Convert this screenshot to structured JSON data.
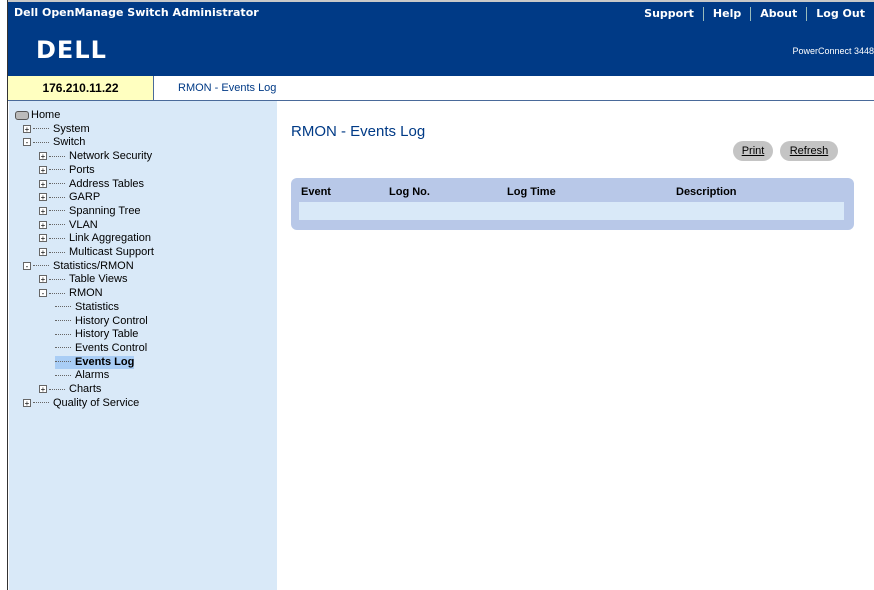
{
  "header": {
    "title": "Dell OpenManage Switch Administrator",
    "links": [
      "Support",
      "Help",
      "About",
      "Log Out"
    ]
  },
  "brand": {
    "logo": "DELL",
    "product": "PowerConnect 3448"
  },
  "ipbar": {
    "ip": "176.210.11.22",
    "breadcrumb": "RMON - Events Log"
  },
  "tree": {
    "items": [
      {
        "label": "Home",
        "level": 0,
        "icon": "home-icon"
      },
      {
        "label": "System",
        "level": 1,
        "toggle": "+"
      },
      {
        "label": "Switch",
        "level": 1,
        "toggle": "-"
      },
      {
        "label": "Network Security",
        "level": 2,
        "toggle": "+"
      },
      {
        "label": "Ports",
        "level": 2,
        "toggle": "+"
      },
      {
        "label": "Address Tables",
        "level": 2,
        "toggle": "+"
      },
      {
        "label": "GARP",
        "level": 2,
        "toggle": "+"
      },
      {
        "label": "Spanning Tree",
        "level": 2,
        "toggle": "+"
      },
      {
        "label": "VLAN",
        "level": 2,
        "toggle": "+"
      },
      {
        "label": "Link Aggregation",
        "level": 2,
        "toggle": "+"
      },
      {
        "label": "Multicast Support",
        "level": 2,
        "toggle": "+"
      },
      {
        "label": "Statistics/RMON",
        "level": 1,
        "toggle": "-"
      },
      {
        "label": "Table Views",
        "level": 2,
        "toggle": "+"
      },
      {
        "label": "RMON",
        "level": 2,
        "toggle": "-"
      },
      {
        "label": "Statistics",
        "level": 3
      },
      {
        "label": "History Control",
        "level": 3
      },
      {
        "label": "History Table",
        "level": 3
      },
      {
        "label": "Events Control",
        "level": 3
      },
      {
        "label": "Events Log",
        "level": 3,
        "selected": true
      },
      {
        "label": "Alarms",
        "level": 3
      },
      {
        "label": "Charts",
        "level": 2,
        "toggle": "+"
      },
      {
        "label": "Quality of Service",
        "level": 1,
        "toggle": "+"
      }
    ]
  },
  "main": {
    "heading": "RMON - Events Log",
    "print_label": "Print",
    "refresh_label": "Refresh",
    "table": {
      "columns": [
        "Event",
        "Log No.",
        "Log Time",
        "Description"
      ],
      "rows": []
    }
  }
}
